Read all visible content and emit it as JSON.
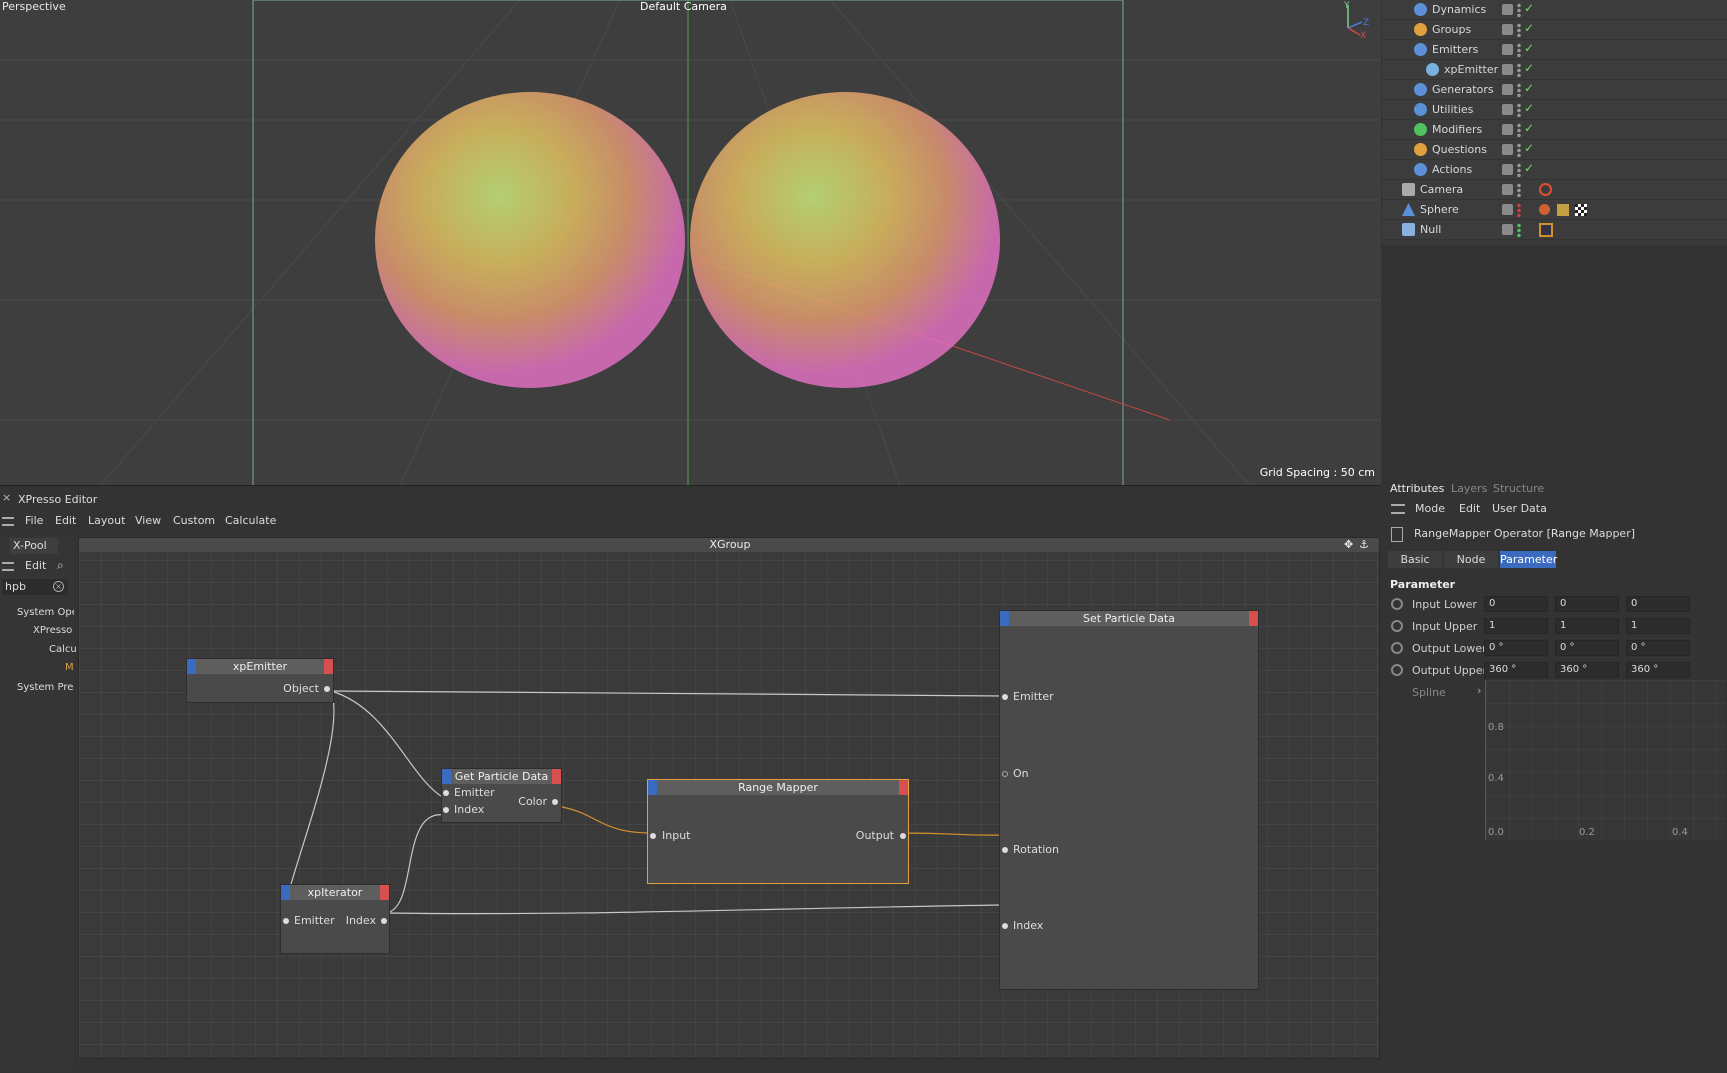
{
  "viewport": {
    "label": "Perspective",
    "camera": "Default Camera",
    "grid_spacing": "Grid Spacing : 50 cm",
    "axis_labels": {
      "y": "Y",
      "z": "Z",
      "x": "X"
    }
  },
  "object_manager": {
    "items": [
      {
        "label": "Dynamics",
        "indent": 2
      },
      {
        "label": "Groups",
        "indent": 2
      },
      {
        "label": "Emitters",
        "indent": 2
      },
      {
        "label": "xpEmitter",
        "indent": 3
      },
      {
        "label": "Generators",
        "indent": 2
      },
      {
        "label": "Utilities",
        "indent": 2
      },
      {
        "label": "Modifiers",
        "indent": 2
      },
      {
        "label": "Questions",
        "indent": 2
      },
      {
        "label": "Actions",
        "indent": 2
      },
      {
        "label": "Camera",
        "indent": 1
      },
      {
        "label": "Sphere",
        "indent": 1
      },
      {
        "label": "Null",
        "indent": 1
      }
    ]
  },
  "attributes": {
    "tabs": [
      "Attributes",
      "Layers",
      "Structure"
    ],
    "menu": [
      "Mode",
      "Edit",
      "User Data"
    ],
    "object_title": "RangeMapper Operator [Range Mapper]",
    "subtabs": [
      "Basic",
      "Node",
      "Parameter"
    ],
    "active_subtab": "Parameter",
    "section": "Parameter",
    "params": [
      {
        "label": "Input Lower",
        "values": [
          "0",
          "0",
          "0"
        ]
      },
      {
        "label": "Input Upper",
        "values": [
          "1",
          "1",
          "1"
        ]
      },
      {
        "label": "Output Lower",
        "values": [
          "0 °",
          "0 °",
          "0 °"
        ]
      },
      {
        "label": "Output Upper",
        "values": [
          "360 °",
          "360 °",
          "360 °"
        ]
      }
    ],
    "spline_label": "Spline",
    "spline_y_ticks": [
      "0.8",
      "0.4"
    ],
    "spline_x_ticks": [
      "0.0",
      "0.2",
      "0.4"
    ]
  },
  "editor": {
    "title": "XPresso Editor",
    "close": "×",
    "menu": [
      "File",
      "Edit",
      "Layout",
      "View",
      "Custom",
      "Calculate"
    ],
    "xpool": {
      "tab": "X-Pool",
      "edit": "Edit",
      "search": "hpb",
      "tree": [
        "System Ope",
        "XPresso",
        "Calcu",
        "M",
        "System Pres"
      ]
    },
    "group_title": "XGroup",
    "nodes": {
      "xpemitter": {
        "title": "xpEmitter",
        "out": "Object"
      },
      "getparticle": {
        "title": "Get Particle Data",
        "in1": "Emitter",
        "in2": "Index",
        "out": "Color"
      },
      "rangemapper": {
        "title": "Range Mapper",
        "in": "Input",
        "out": "Output"
      },
      "xpiterator": {
        "title": "xpIterator",
        "in": "Emitter",
        "out": "Index"
      },
      "setparticle": {
        "title": "Set Particle Data",
        "p1": "Emitter",
        "p2": "On",
        "p3": "Rotation",
        "p4": "Index"
      }
    }
  },
  "colors": {
    "accent": "#3b7bd6",
    "node_selected": "#e0a040",
    "wire": "#c8c8c8",
    "wire_orange": "#d9902f"
  }
}
